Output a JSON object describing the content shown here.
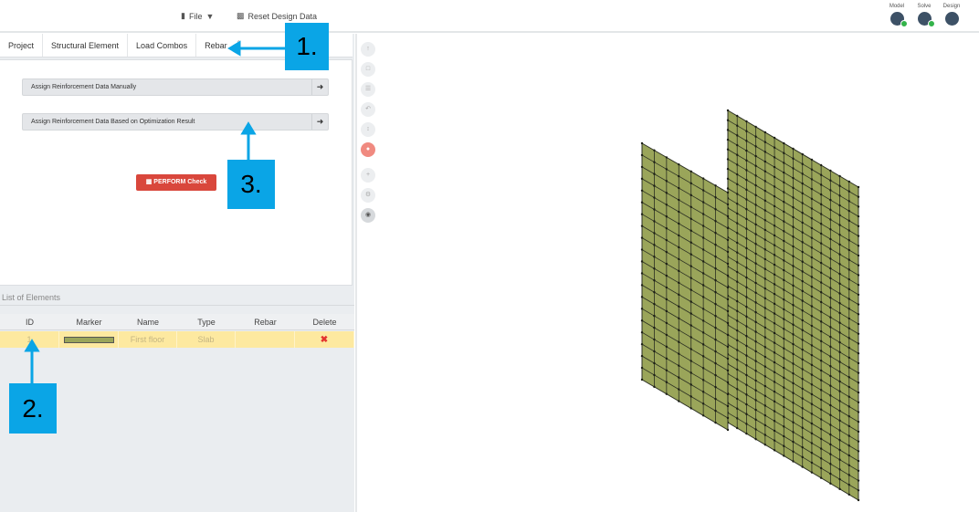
{
  "toolbar": {
    "file_label": "File",
    "reset_label": "Reset Design Data"
  },
  "workflow": {
    "steps": [
      {
        "label": "Model"
      },
      {
        "label": "Solve"
      },
      {
        "label": "Design"
      }
    ]
  },
  "tabs": [
    {
      "label": "Project"
    },
    {
      "label": "Structural Element"
    },
    {
      "label": "Load Combos"
    },
    {
      "label": "Rebar"
    }
  ],
  "rebar_panel": {
    "manual_label": "Assign Reinforcement Data Manually",
    "optimization_label": "Assign Reinforcement Data Based on Optimization Result",
    "perform_label": "PERFORM Check"
  },
  "elements_list": {
    "header": "List of Elements",
    "columns": [
      "ID",
      "Marker",
      "Name",
      "Type",
      "Rebar",
      "Delete"
    ],
    "rows": [
      {
        "id": "1",
        "name": "First floor",
        "type": "Slab",
        "rebar": "",
        "marker_color": "#9aa55a"
      }
    ]
  },
  "annotations": {
    "one": "1.",
    "two": "2.",
    "three": "3."
  },
  "colors": {
    "accent_callout": "#0aa5e6",
    "perform_red": "#d9473c",
    "mesh_fill": "#9aa55a",
    "selected_row": "#fde9a0"
  },
  "icons": {
    "file": "file-icon",
    "reset": "trash-icon",
    "arrow": "arrow-right-icon",
    "delete": "delete-x-icon"
  }
}
